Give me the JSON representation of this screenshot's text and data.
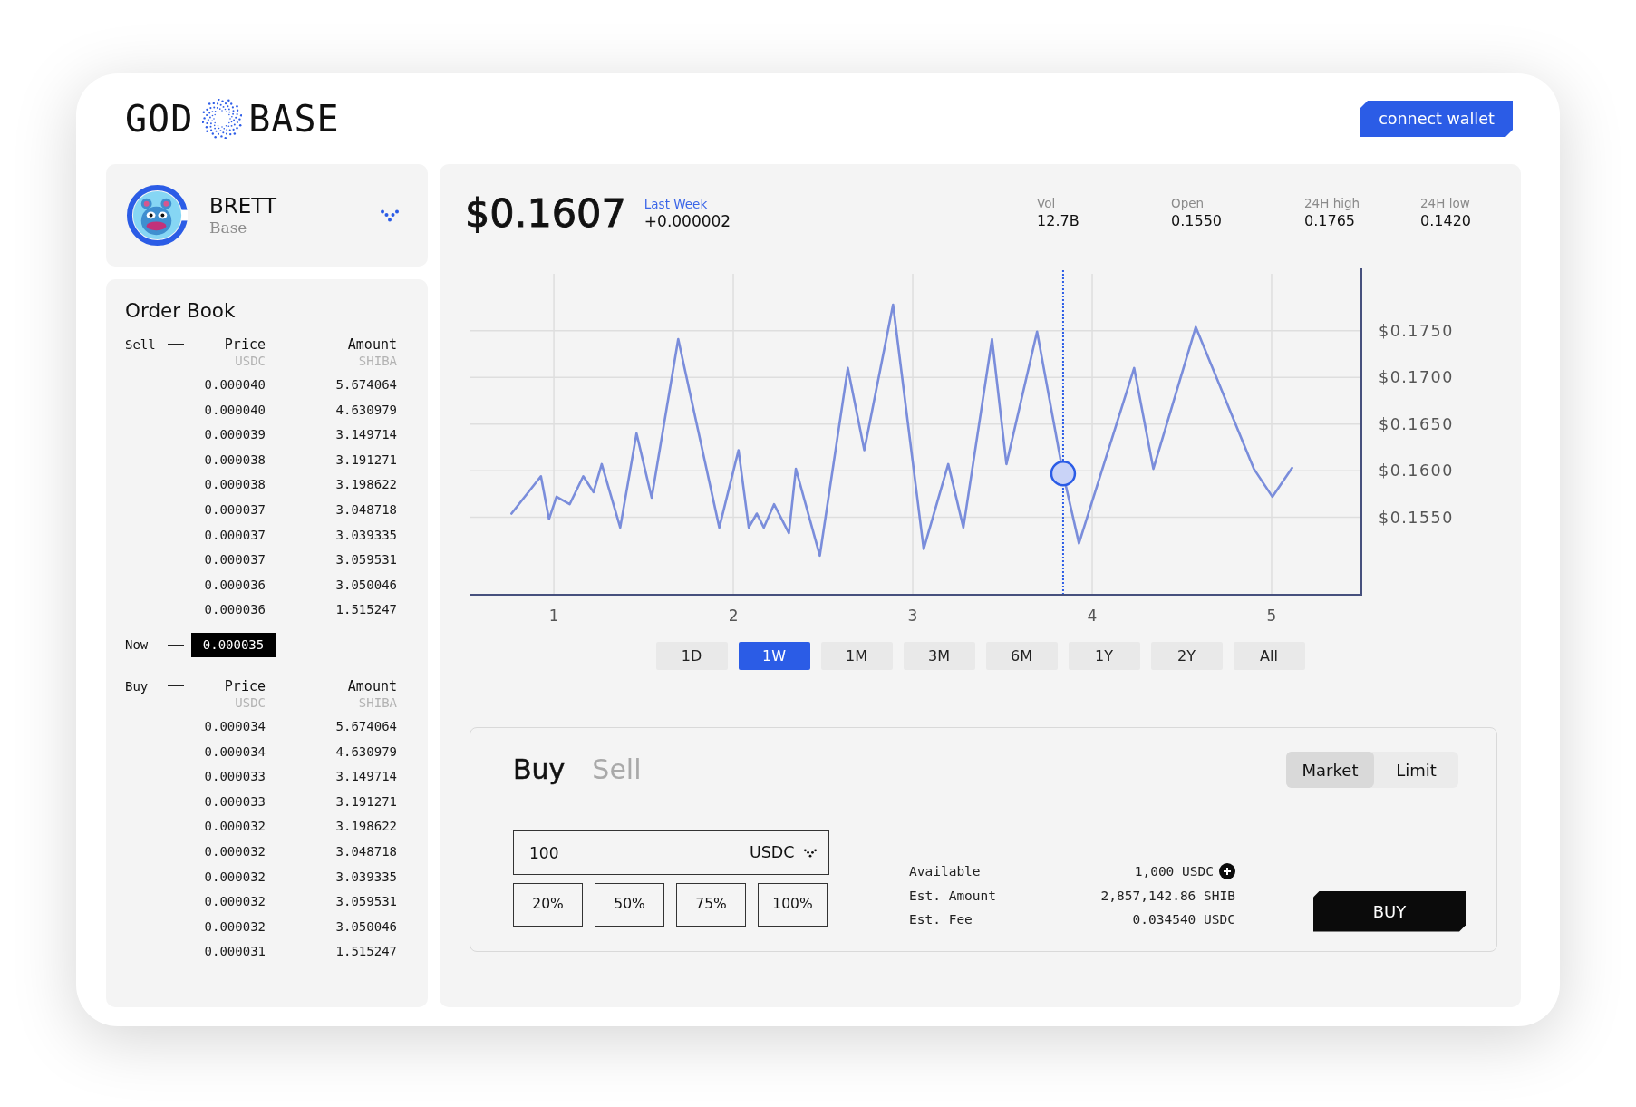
{
  "header": {
    "logo_left": "GOD",
    "logo_right": "BASE",
    "connect_button": "connect wallet"
  },
  "token": {
    "name": "BRETT",
    "network": "Base"
  },
  "order_book": {
    "title": "Order Book",
    "sell": {
      "label": "Sell",
      "columns": [
        {
          "label": "Price",
          "unit": "USDC"
        },
        {
          "label": "Amount",
          "unit": "SHIBA"
        }
      ],
      "rows": [
        {
          "price": "0.000040",
          "amount": "5.674064"
        },
        {
          "price": "0.000040",
          "amount": "4.630979"
        },
        {
          "price": "0.000039",
          "amount": "3.149714"
        },
        {
          "price": "0.000038",
          "amount": "3.191271"
        },
        {
          "price": "0.000038",
          "amount": "3.198622"
        },
        {
          "price": "0.000037",
          "amount": "3.048718"
        },
        {
          "price": "0.000037",
          "amount": "3.039335"
        },
        {
          "price": "0.000037",
          "amount": "3.059531"
        },
        {
          "price": "0.000036",
          "amount": "3.050046"
        },
        {
          "price": "0.000036",
          "amount": "1.515247"
        }
      ]
    },
    "now": {
      "label": "Now",
      "price": "0.000035"
    },
    "buy": {
      "label": "Buy",
      "columns": [
        {
          "label": "Price",
          "unit": "USDC"
        },
        {
          "label": "Amount",
          "unit": "SHIBA"
        }
      ],
      "rows": [
        {
          "price": "0.000034",
          "amount": "5.674064"
        },
        {
          "price": "0.000034",
          "amount": "4.630979"
        },
        {
          "price": "0.000033",
          "amount": "3.149714"
        },
        {
          "price": "0.000033",
          "amount": "3.191271"
        },
        {
          "price": "0.000032",
          "amount": "3.198622"
        },
        {
          "price": "0.000032",
          "amount": "3.048718"
        },
        {
          "price": "0.000032",
          "amount": "3.039335"
        },
        {
          "price": "0.000032",
          "amount": "3.059531"
        },
        {
          "price": "0.000032",
          "amount": "3.050046"
        },
        {
          "price": "0.000031",
          "amount": "1.515247"
        }
      ]
    }
  },
  "market": {
    "price": "$0.1607",
    "change_label": "Last Week",
    "change": "+0.000002",
    "stats": [
      {
        "label": "Vol",
        "value": "12.7B"
      },
      {
        "label": "Open",
        "value": "0.1550"
      },
      {
        "label": "24H high",
        "value": "0.1765"
      },
      {
        "label": "24H low",
        "value": "0.1420"
      }
    ],
    "chart_data": {
      "type": "line",
      "x": [
        0.764,
        0.928,
        0.973,
        1.015,
        1.088,
        1.164,
        1.221,
        1.267,
        1.37,
        1.461,
        1.545,
        1.693,
        1.922,
        2.029,
        2.086,
        2.131,
        2.17,
        2.227,
        2.31,
        2.349,
        2.482,
        2.638,
        2.73,
        2.89,
        3.061,
        3.198,
        3.282,
        3.442,
        3.522,
        3.693,
        3.838,
        3.926,
        4.234,
        4.341,
        4.577,
        4.901,
        5.004,
        5.114
      ],
      "series": [
        {
          "color": "#7a8ddb",
          "values": [
            0.1554,
            0.1594,
            0.1548,
            0.1572,
            0.1564,
            0.1594,
            0.1577,
            0.1607,
            0.1539,
            0.164,
            0.1571,
            0.1741,
            0.1539,
            0.1622,
            0.1539,
            0.1554,
            0.1539,
            0.1564,
            0.1533,
            0.1602,
            0.1509,
            0.171,
            0.1622,
            0.1778,
            0.1516,
            0.1607,
            0.1539,
            0.1741,
            0.1607,
            0.1749,
            0.1597,
            0.1522,
            0.171,
            0.1602,
            0.1754,
            0.1602,
            0.1572,
            0.1603
          ]
        }
      ],
      "xlim": [
        0.53,
        5.5
      ],
      "ylim": [
        0.1467,
        0.1811
      ],
      "xticks": [
        1,
        2,
        3,
        4,
        5
      ],
      "yticks": [
        {
          "value": 0.155,
          "label": "$0.1550"
        },
        {
          "value": 0.16,
          "label": "$0.1600"
        },
        {
          "value": 0.165,
          "label": "$0.1650"
        },
        {
          "value": 0.17,
          "label": "$0.1700"
        },
        {
          "value": 0.175,
          "label": "$0.1750"
        }
      ],
      "grid": true,
      "ref_lines": [
        {
          "axis": "x",
          "value": 3.838,
          "color": "#2b5ce6"
        }
      ]
    },
    "ranges": [
      {
        "label": "1D",
        "selected": false
      },
      {
        "label": "1W",
        "selected": true
      },
      {
        "label": "1M",
        "selected": false
      },
      {
        "label": "3M",
        "selected": false
      },
      {
        "label": "6M",
        "selected": false
      },
      {
        "label": "1Y",
        "selected": false
      },
      {
        "label": "2Y",
        "selected": false
      },
      {
        "label": "All",
        "selected": false
      }
    ]
  },
  "trade": {
    "sides": [
      {
        "label": "Buy",
        "selected": true
      },
      {
        "label": "Sell",
        "selected": false
      }
    ],
    "order_types": [
      {
        "label": "Market",
        "selected": true
      },
      {
        "label": "Limit",
        "selected": false
      }
    ],
    "amount_field": {
      "value": "100",
      "currency": "USDC"
    },
    "percent_buttons": [
      "20%",
      "50%",
      "75%",
      "100%"
    ],
    "summary": [
      {
        "kind": "topup",
        "label": "Available",
        "value": "1,000 USDC"
      },
      {
        "kind": "plain",
        "label": "Est. Amount",
        "value": "2,857,142.86 SHIB"
      },
      {
        "kind": "plain",
        "label": "Est. Fee",
        "value": "0.034540 USDC"
      }
    ],
    "submit_button": "BUY"
  }
}
